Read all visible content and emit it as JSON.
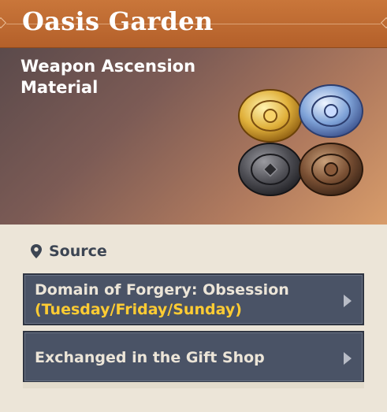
{
  "header": {
    "title": "Oasis Garden"
  },
  "hero": {
    "type_line1": "Weapon Ascension",
    "type_line2": "Material"
  },
  "icons": {
    "gems": "oasis-garden-material-icons",
    "location": "location-pin-icon",
    "chevron": "chevron-right-icon"
  },
  "source": {
    "heading": "Source",
    "items": [
      {
        "label": "Domain of Forgery: Obsession",
        "sub": "(Tuesday/Friday/Sunday)"
      },
      {
        "label": "Exchanged in the Gift Shop"
      }
    ]
  },
  "colors": {
    "header": "#b4602a",
    "row_bg": "#4a5366",
    "highlight": "#ffcc33",
    "panel": "#ece5d8"
  }
}
